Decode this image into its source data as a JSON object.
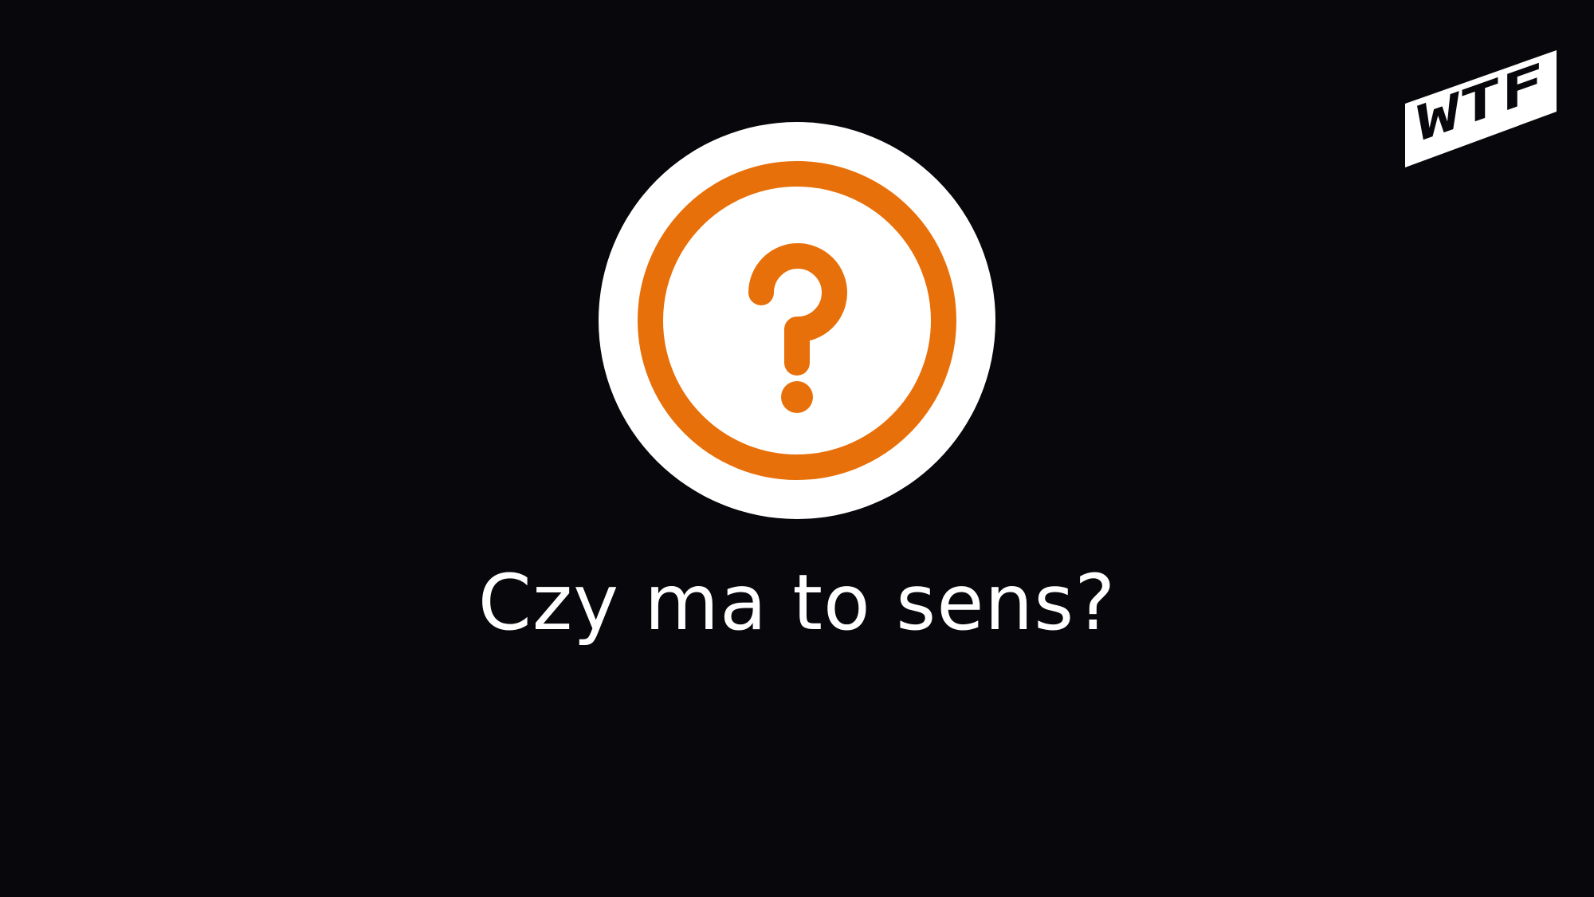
{
  "slide": {
    "caption": "Czy ma to sens?",
    "icon": "question-circle-icon",
    "logo_text": "WTF"
  },
  "colors": {
    "background": "#08070c",
    "accent": "#e8700a",
    "foreground": "#ffffff"
  }
}
